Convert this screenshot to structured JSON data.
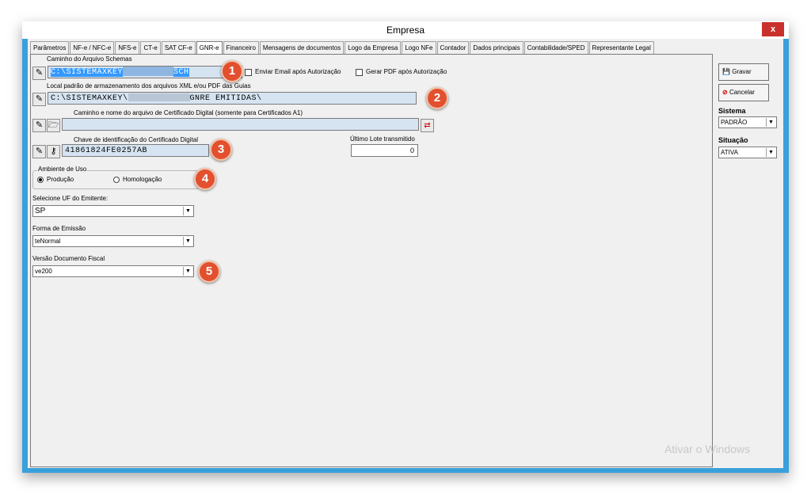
{
  "window": {
    "title": "Empresa",
    "close_label": "x"
  },
  "tabs": [
    "Parâmetros",
    "NF-e / NFC-e",
    "NFS-e",
    "CT-e",
    "SAT CF-e",
    "GNR-e",
    "Financeiro",
    "Mensagens de documentos",
    "Logo da Empresa",
    "Logo NFe",
    "Contador",
    "Dados principais",
    "Contabilidade/SPED",
    "Representante Legal"
  ],
  "active_tab": "GNR-e",
  "form": {
    "schemas_label": "Caminho do Arquivo Schemas",
    "schemas_value": "C:\\SISTEMAXKEY",
    "schemas_value_tail": "SCH",
    "email_label": "Enviar Email após Autorização",
    "pdf_label": "Gerar PDF após Autorização",
    "storage_label": "Local padrão de armazenamento dos arquivos XML e/ou PDF das Guias",
    "storage_value": "C:\\SISTEMAXKEY\\",
    "storage_value_tail": "GNRE EMITIDAS\\",
    "cert_path_label": "Caminho e nome do arquivo de Certificado Digital (somente para Certificados A1)",
    "cert_path_value": "",
    "cert_key_label": "Chave de identificação do Certificado Digital",
    "cert_key_value": "41861824FE0257AB",
    "last_batch_label": "Último Lote transmitido",
    "last_batch_value": "0",
    "env_group_label": "Ambiente de Uso",
    "env_production": "Produção",
    "env_homologation": "Homologação",
    "uf_label": "Selecione UF do Emitente:",
    "uf_value": "SP",
    "emission_label": "Forma de Emissão",
    "emission_value": "teNormal",
    "version_label": "Versão Documento Fiscal",
    "version_value": "ve200"
  },
  "badges": [
    "1",
    "2",
    "3",
    "4",
    "5"
  ],
  "side": {
    "save_label": "Gravar",
    "cancel_label": "Cancelar",
    "system_label": "Sistema",
    "system_value": "PADRÃO",
    "status_label": "Situação",
    "status_value": "ATIVA"
  },
  "watermark": "Ativar o Windows",
  "colors": {
    "titlebar_border": "#3aa0db",
    "badge": "#e2502f",
    "close": "#c9302c",
    "selection": "#3399ff"
  }
}
